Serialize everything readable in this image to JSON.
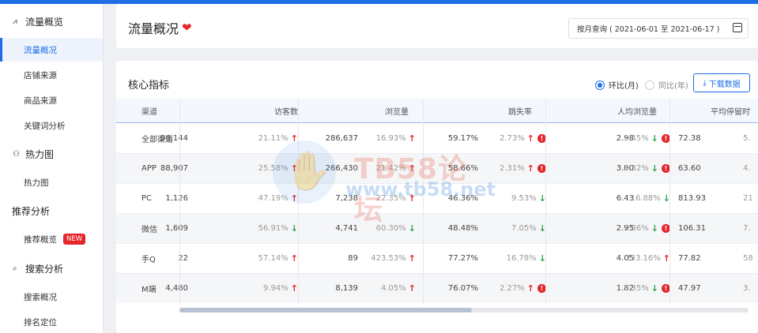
{
  "sidebar": {
    "items": [
      {
        "type": "section",
        "icon": "traffic-icon",
        "glyph": "⩘",
        "label": "流量概览"
      },
      {
        "type": "sub",
        "label": "流量概况",
        "active": true
      },
      {
        "type": "sub",
        "label": "店铺来源"
      },
      {
        "type": "sub",
        "label": "商品来源"
      },
      {
        "type": "sub",
        "label": "关键词分析"
      },
      {
        "type": "section",
        "icon": "heatmap-icon",
        "glyph": "⚇",
        "label": "热力图"
      },
      {
        "type": "sub",
        "label": "热力图"
      },
      {
        "type": "section",
        "label": "推荐分析"
      },
      {
        "type": "sub",
        "label": "推荐概览",
        "badge": "NEW"
      },
      {
        "type": "section",
        "icon": "search-icon",
        "glyph": "⌕",
        "label": "搜索分析"
      },
      {
        "type": "sub",
        "label": "搜索概况"
      },
      {
        "type": "sub",
        "label": "排名定位"
      }
    ]
  },
  "header": {
    "title": "流量概况",
    "date_query": "按月查询 ( 2021-06-01 至 2021-06-17 )"
  },
  "main": {
    "section_title": "核心指标",
    "radio_mom": "环比(月)",
    "radio_yoy": "同比(年)",
    "download_label": "下载数据",
    "columns": [
      "渠道",
      "访客数",
      "浏览量",
      "跳失率",
      "人均浏览量",
      "平均停留时"
    ],
    "rows": [
      {
        "channel": "全部渠道",
        "visitors": "96,144",
        "visitors_pct": "21.11%",
        "visitors_dir": "up",
        "pv": "286,637",
        "pv_pct": "16.93%",
        "pv_dir": "up",
        "bounce": "59.17%",
        "bounce_pct": "2.73%",
        "bounce_dir": "up",
        "bounce_warn": true,
        "avg_pv": "2.98",
        "avg_pv_pct": "3.45%",
        "avg_pv_dir": "down",
        "avg_pv_warn": true,
        "stay": "72.38",
        "stay_pct": "5."
      },
      {
        "channel": "APP",
        "visitors": "88,907",
        "visitors_pct": "25.58%",
        "visitors_dir": "up",
        "pv": "266,430",
        "pv_pct": "21.42%",
        "pv_dir": "up",
        "bounce": "58.66%",
        "bounce_pct": "2.31%",
        "bounce_dir": "up",
        "bounce_warn": true,
        "avg_pv": "3.00",
        "avg_pv_pct": "3.32%",
        "avg_pv_dir": "down",
        "avg_pv_warn": true,
        "stay": "63.60",
        "stay_pct": "4."
      },
      {
        "channel": "PC",
        "visitors": "1,126",
        "visitors_pct": "47.19%",
        "visitors_dir": "up",
        "pv": "7,238",
        "pv_pct": "22.35%",
        "pv_dir": "up",
        "bounce": "46.36%",
        "bounce_pct": "9.53%",
        "bounce_dir": "down",
        "bounce_warn": false,
        "avg_pv": "6.43",
        "avg_pv_pct": "16.88%",
        "avg_pv_dir": "down",
        "avg_pv_warn": false,
        "stay": "813.93",
        "stay_pct": "21"
      },
      {
        "channel": "微信",
        "visitors": "1,609",
        "visitors_pct": "56.91%",
        "visitors_dir": "down",
        "pv": "4,741",
        "pv_pct": "60.30%",
        "pv_dir": "down",
        "bounce": "48.48%",
        "bounce_pct": "7.05%",
        "bounce_dir": "down",
        "bounce_warn": false,
        "avg_pv": "2.95",
        "avg_pv_pct": "7.86%",
        "avg_pv_dir": "down",
        "avg_pv_warn": true,
        "stay": "106.31",
        "stay_pct": "7."
      },
      {
        "channel": "手Q",
        "visitors": "22",
        "visitors_pct": "57.14%",
        "visitors_dir": "up",
        "pv": "89",
        "pv_pct": "423.53%",
        "pv_dir": "up",
        "bounce": "77.27%",
        "bounce_pct": "16.78%",
        "bounce_dir": "down",
        "bounce_warn": false,
        "avg_pv": "4.05",
        "avg_pv_pct": "233.16%",
        "avg_pv_dir": "up",
        "avg_pv_warn": false,
        "stay": "77.82",
        "stay_pct": "58"
      },
      {
        "channel": "M端",
        "visitors": "4,480",
        "visitors_pct": "9.94%",
        "visitors_dir": "up",
        "pv": "8,139",
        "pv_pct": "4.05%",
        "pv_dir": "up",
        "bounce": "76.07%",
        "bounce_pct": "2.27%",
        "bounce_dir": "up",
        "bounce_warn": true,
        "avg_pv": "1.82",
        "avg_pv_pct": "5.35%",
        "avg_pv_dir": "down",
        "avg_pv_warn": true,
        "stay": "47.97",
        "stay_pct": "3."
      }
    ]
  },
  "watermark": {
    "line1": "TB58论坛",
    "line2": "www.tb58.net"
  },
  "colors": {
    "accent": "#1e6fe6",
    "up": "#e4252a",
    "down": "#2ca44b"
  }
}
